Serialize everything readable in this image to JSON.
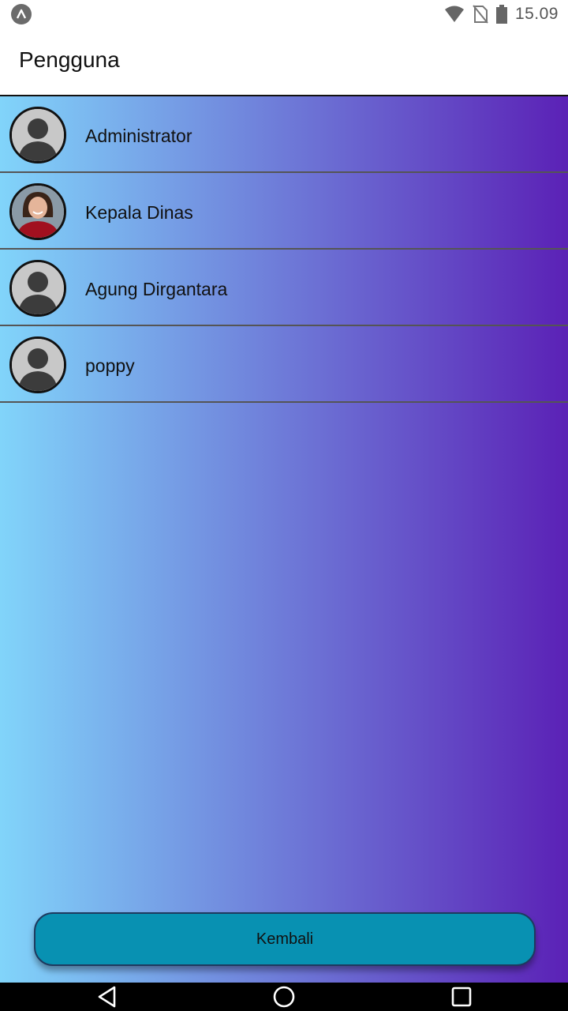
{
  "status_bar": {
    "time": "15.09",
    "icons": [
      "app-notification-icon",
      "wifi-icon",
      "no-sim-icon",
      "battery-icon"
    ]
  },
  "app_bar": {
    "title": "Pengguna"
  },
  "users": [
    {
      "name": "Administrator",
      "avatar": "default-avatar-icon"
    },
    {
      "name": "Kepala Dinas",
      "avatar": "photo-avatar"
    },
    {
      "name": "Agung Dirgantara",
      "avatar": "default-avatar-icon"
    },
    {
      "name": "poppy",
      "avatar": "default-avatar-icon"
    }
  ],
  "back_button": {
    "label": "Kembali"
  },
  "nav_bar": {
    "icons": [
      "back-icon",
      "home-icon",
      "recents-icon"
    ]
  },
  "colors": {
    "gradient_start": "#81d4fa",
    "gradient_end": "#5b21b6",
    "button": "#0891b2"
  }
}
